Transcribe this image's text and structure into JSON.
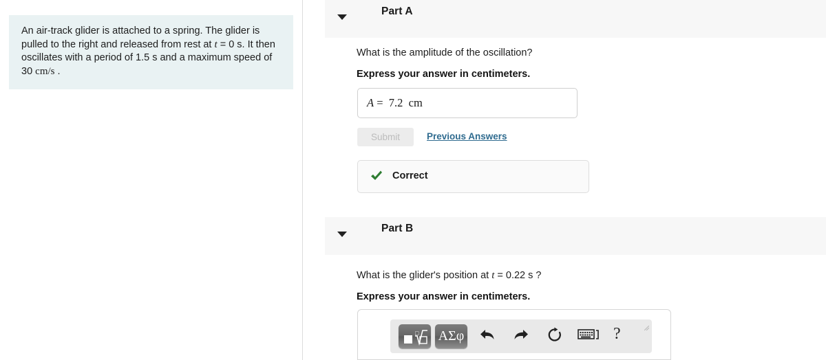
{
  "problem": {
    "text_part1": "An air-track glider is attached to a spring. The glider is pulled to the right and released from rest at ",
    "var_t": "t",
    "eq_zero": " = 0 s. It then oscillates with a period of 1.5 s and a maximum speed of 30 ",
    "units_cm_s": "cm/s",
    "period_end": " ."
  },
  "part_a": {
    "caret": "caret-down-icon",
    "title": "Part A",
    "question": "What is the amplitude of the oscillation?",
    "instruction": "Express your answer in centimeters.",
    "answer": {
      "symbol": "A",
      "equals": "=",
      "value": "7.2",
      "units": "cm",
      "full": "A =  7.2  cm"
    },
    "submit_label": "Submit",
    "previous_answers_label": "Previous Answers",
    "feedback": {
      "icon": "check-icon",
      "label": "Correct",
      "color": "#2e7d32"
    }
  },
  "part_b": {
    "caret": "caret-down-icon",
    "title": "Part B",
    "question_part1": "What is the glider's position at ",
    "question_var": "t",
    "question_part2": " = 0.22 s ?",
    "instruction": "Express your answer in centimeters.",
    "toolbar": {
      "template_button": "math-template-icon",
      "greek_button": "ΑΣφ",
      "undo": "undo-icon",
      "redo": "redo-icon",
      "reset": "reset-icon",
      "keyboard": "keyboard-shortcuts-icon",
      "help": "?"
    }
  },
  "colors": {
    "problem_bg": "#e9f2f3",
    "header_bg": "#f7f7f7",
    "link": "#2f6b8f",
    "correct_green": "#2e7d32",
    "toolbar_bg": "#e9e9e9"
  }
}
